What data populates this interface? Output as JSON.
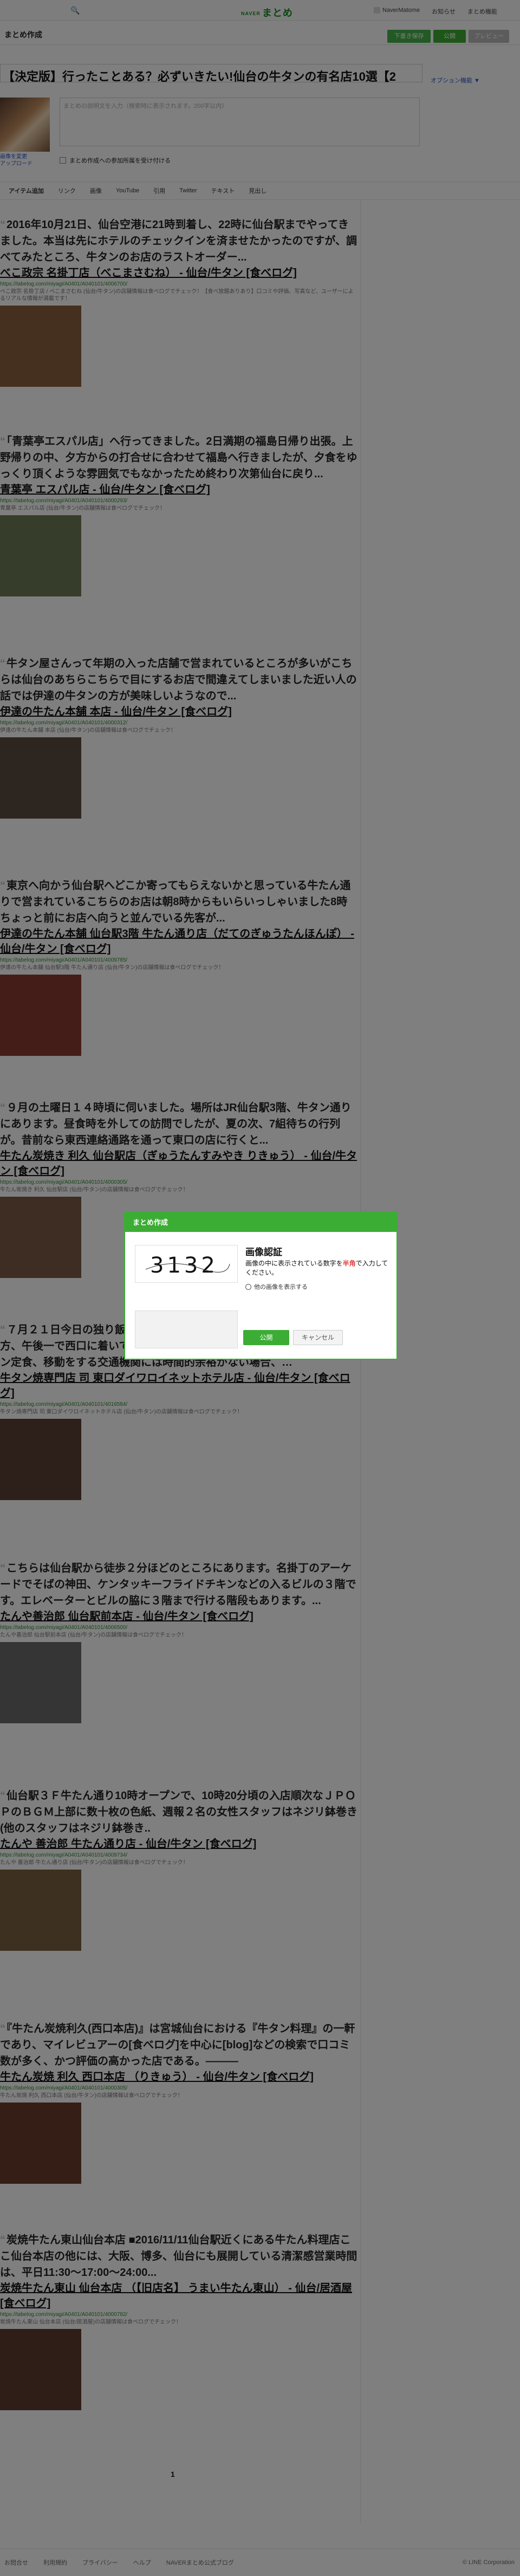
{
  "header": {
    "search_icon": "search-icon",
    "logo_prefix": "NAVER",
    "logo": "まとめ",
    "user": "NaverMatome",
    "links": [
      "お知らせ",
      "まとめ機能"
    ]
  },
  "subhead": {
    "title": "まとめ作成",
    "buttons": [
      "下書き保存",
      "公開",
      "プレビュー"
    ]
  },
  "editor": {
    "title": "【決定版】行ったことある？必ずいきたい!仙台の牛タンの有名店10選【2",
    "option_link": "オプション機能 ▼",
    "change_link": "画像を変更\nアップロード",
    "desc_placeholder": "まとめの説明文を入力（検索時に表示されます。200字以内）",
    "checkbox_label": "まとめ作成への参加所属を受け付ける"
  },
  "tabs": [
    "アイテム追加",
    "リンク",
    "画像",
    "YouTube",
    "引用",
    "Twitter",
    "テキスト",
    "見出し"
  ],
  "posts": [
    {
      "quote": "2016年10月21日、仙台空港に21時到着し、22時に仙台駅までやってきました。本当は先にホテルのチェックインを済ませたかったのですが、調べてみたところ、牛タンのお店のラストオーダー...",
      "link": "べこ政宗 名掛丁店（べこまさむね） - 仙台/牛タン [食べログ]",
      "url": "https://tabelog.com/miyagi/A0401/A040101/4006700/",
      "excerpt": "べこ政宗 名掛丁店 / べこまさむね (仙台/牛タン)の店舗情報は食べログでチェック！【食べ放題ありあり】口コミや評価、写真など、ユーザーによるリアルな情報が満載です！"
    },
    {
      "quote": "「青葉亭エスパル店」へ行ってきました。2日満期の福島日帰り出張。上野帰りの中、夕方からの打合せに合わせて福島へ行きましたが、夕食をゆっくり頂くような雰囲気でもなかったため終わり次第仙台に戻り...",
      "link": "青葉亭 エスパル店 - 仙台/牛タン [食べログ]",
      "url": "https://tabelog.com/miyagi/A0401/A040101/4000293/",
      "excerpt": "青葉亭 エスパル店 (仙台/牛タン)の店舗情報は食べログでチェック！"
    },
    {
      "quote": "牛タン屋さんって年期の入った店舗で営まれているところが多いがこちらは仙台のあちらこちらで目にするお店で間違えてしまいました近い人の話では伊達の牛タンの方が美味しいようなので...",
      "link": "伊達の牛たん本舗 本店 - 仙台/牛タン [食べログ]",
      "url": "https://tabelog.com/miyagi/A0401/A040101/4000312/",
      "excerpt": "伊達の牛たん本舗 本店 (仙台/牛タン)の店舗情報は食べログでチェック！"
    },
    {
      "quote": "東京へ向かう仙台駅へどこか寄ってもらえないかと思っている牛たん通りで営まれているこちらのお店は朝8時からもいらいっしゃいました8時ちょっと前にお店へ向うと並んでいる先客が...",
      "link": "伊達の牛たん本舗 仙台駅3階 牛たん通り店（だてのぎゅうたんほんぽ） - 仙台/牛タン [食べログ]",
      "url": "https://tabelog.com/miyagi/A0401/A040101/4009785/",
      "excerpt": "伊達の牛たん本舗 仙台駅3階 牛たん通り店 (仙台/牛タン)の店舗情報は食べログでチェック！"
    },
    {
      "quote": "９月の土曜日１４時頃に伺いました。場所はJR仙台駅3階、牛タン通りにあります。昼食時を外しての訪問でしたが、夏の次、7組待ちの行列が。昔前なら東西連絡通路を通って東口の店に行くと...",
      "link": "牛たん炭焼き 利久 仙台駅店（ぎゅうたんすみやき りきゅう） - 仙台/牛タン [食べログ]",
      "url": "https://tabelog.com/miyagi/A0401/A040101/4000305/",
      "excerpt": "牛たん炭焼き 利久 仙台駅店 (仙台/牛タン)の店舗情報は食べログでチェック！"
    },
    {
      "quote": "７月２１日今日の独り飯は、仙台出張の帰りに寄りました。日曜日の夕方、午後一で西口に着いてから、一仕事あった後にこちらのお店へ。牛タン定食、移動をする交通機関には時間的余裕がない場合、…",
      "link": "牛タン焼専門店 司 東口ダイワロイネットホテル店 - 仙台/牛タン [食べログ]",
      "url": "https://tabelog.com/miyagi/A0401/A040101/4016584/",
      "excerpt": "牛タン焼専門店 司 東口ダイワロイネットホテル店 (仙台/牛タン)の店舗情報は食べログでチェック！"
    },
    {
      "quote": "こちらは仙台駅から徒歩２分ほどのところにあります。名掛丁のアーケードでそばの神田、ケンタッキーフライドチキンなどの入るビルの３階です。エレベーターとビルの脇に３階まで行ける階段もあります。...",
      "link": "たんや善治郎 仙台駅前本店 - 仙台/牛タン [食べログ]",
      "url": "https://tabelog.com/miyagi/A0401/A040101/4006500/",
      "excerpt": "たんや善治郎 仙台駅前本店 (仙台/牛タン)の店舗情報は食べログでチェック！"
    },
    {
      "quote": "仙台駅３Ｆ牛たん通り10時オープンで、10時20分頃の入店順次なＪＰＯＰのＢＧＭ上部に数十枚の色紙、週報２名の女性スタッフはネジリ鉢巻き(他のスタッフはネジリ鉢巻き..",
      "link": "たんや 善治郎 牛たん通り店 - 仙台/牛タン [食べログ]",
      "url": "https://tabelog.com/miyagi/A0401/A040101/4009734/",
      "excerpt": "たんや 善治郎 牛たん通り店 (仙台/牛タン)の店舗情報は食べログでチェック！"
    },
    {
      "quote": "『牛たん炭焼利久(西口本店)』は宮城仙台における『牛タン料理』の一軒であり、マイレビュアーの[食べログ]を中心に[blog]などの検索で口コミ数が多く、かつ評価の高かった店である。———",
      "link": "牛たん炭焼 利久 西口本店 （りきゅう） - 仙台/牛タン [食べログ]",
      "url": "https://tabelog.com/miyagi/A0401/A040101/4000305/",
      "excerpt": "牛たん炭焼 利久 西口本店 (仙台/牛タン)の店舗情報は食べログでチェック！"
    },
    {
      "quote": "炭焼牛たん東山仙台本店 ■2016/11/11仙台駅近くにある牛たん料理店ここ仙台本店の他には、大阪、博多、仙台にも展開している清潔感営業時間は、平日11:30〜17:00〜24:00...",
      "link": "炭焼牛たん東山 仙台本店 （【旧店名】 うまい牛たん東山） - 仙台/居酒屋 [食べログ]",
      "url": "https://tabelog.com/miyagi/A0401/A040101/4000782/",
      "excerpt": "炭焼牛たん東山 仙台本店 (仙台/居酒屋)の店舗情報は食べログでチェック！"
    }
  ],
  "pager": "1",
  "footer": {
    "links": [
      "お問合せ",
      "利用規約",
      "プライバシー",
      "ヘルプ",
      "NAVERまとめ公式ブログ"
    ],
    "copyright": "© LINE Corporation"
  },
  "modal": {
    "header": "まとめ作成",
    "captcha_text": "3132",
    "title": "画像認証",
    "desc_a": "画像の中に表示されている数字を",
    "desc_em": "半角",
    "desc_b": "で入力してください。",
    "refresh": "他の画像を表示する",
    "ok": "公開",
    "cancel": "キャンセル"
  }
}
